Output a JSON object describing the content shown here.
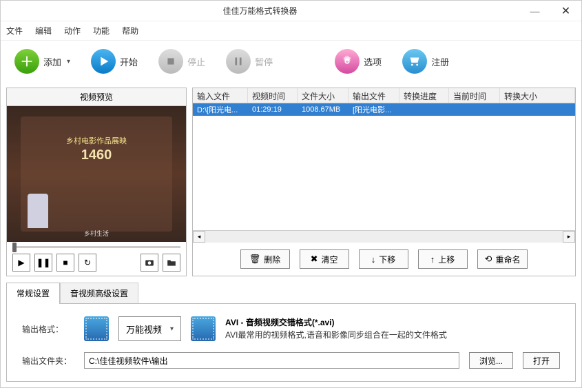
{
  "window": {
    "title": "佳佳万能格式转换器"
  },
  "menu": {
    "file": "文件",
    "edit": "编辑",
    "action": "动作",
    "function": "功能",
    "help": "帮助"
  },
  "toolbar": {
    "add": "添加",
    "start": "开始",
    "stop": "停止",
    "pause": "暂停",
    "options": "选项",
    "register": "注册"
  },
  "preview": {
    "header": "视频预览",
    "topText": "乡村电影作品展映",
    "number": "1460",
    "sub": "乡村生活"
  },
  "table": {
    "headers": {
      "input": "输入文件",
      "duration": "视频时间",
      "size": "文件大小",
      "output": "输出文件",
      "progress": "转换进度",
      "current": "当前时间",
      "outsize": "转换大小"
    },
    "row": {
      "input": "D:\\[阳光电...",
      "duration": "01:29:19",
      "size": "1008.67MB",
      "output": "[阳光电影..."
    }
  },
  "actions": {
    "delete": "删除",
    "clear": "清空",
    "down": "下移",
    "up": "上移",
    "rename": "重命名"
  },
  "tabs": {
    "general": "常规设置",
    "advanced": "音视频高级设置"
  },
  "settings": {
    "outputFormatLabel": "输出格式：",
    "formatBtn": "万能视频",
    "formatTitle": "AVI - 音频视频交错格式(*.avi)",
    "formatDesc": "AVI最常用的视频格式,语音和影像同步组合在一起的文件格式",
    "outputFolderLabel": "输出文件夹：",
    "outputPath": "C:\\佳佳视频软件\\输出",
    "browse": "浏览...",
    "open": "打开"
  }
}
